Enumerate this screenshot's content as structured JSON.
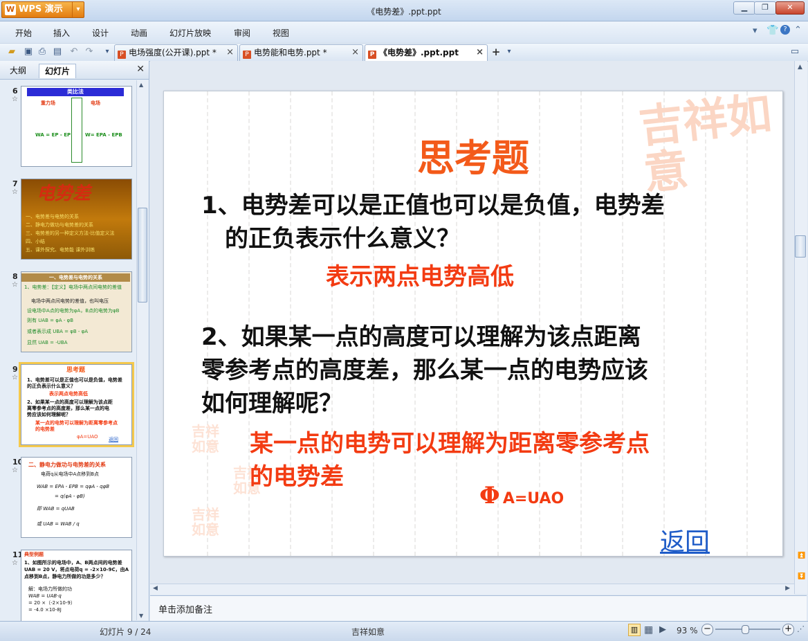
{
  "app": {
    "name": "WPS 演示",
    "window_title": "《电势差》.ppt.ppt"
  },
  "menu": [
    "开始",
    "插入",
    "设计",
    "动画",
    "幻灯片放映",
    "审阅",
    "视图"
  ],
  "tabs": [
    {
      "label": "电场强度(公开课).ppt *",
      "active": false
    },
    {
      "label": "电势能和电势.ppt *",
      "active": false
    },
    {
      "label": "《电势差》.ppt.ppt",
      "active": true
    }
  ],
  "left_panel": {
    "tabs": [
      "大纲",
      "幻灯片"
    ],
    "active_tab": "幻灯片",
    "thumbnails": [
      {
        "num": "6",
        "title": "类比法",
        "lines": [
          "重力场",
          "电场",
          "WA = EP - EP",
          "W= EPA - EPB"
        ]
      },
      {
        "num": "7",
        "title": "电势差",
        "lines": [
          "一、电势差与电势的关系",
          "二、静电力做功与电势差的关系",
          "三、电势差的另一种定义方法-比值定义法",
          "四、小结",
          "五、课外探究、电势能   课外训练"
        ]
      },
      {
        "num": "8",
        "title": "一、电势差与电势的关系",
        "lines": [
          "1、电势差：【定义】电场中两点间电势的差值",
          "电场中两点间电势的差值，也叫电压",
          "设电场中A点的电势为φA，B点的电势为φB",
          "则有  UAB = φA - φB",
          "或者表示成  UBA = φB - φA",
          "显然  UAB = -UBA"
        ]
      },
      {
        "num": "9",
        "title": "思考题",
        "lines": [
          "1、电势差可以是正值也可以是负值，电势差的正负表示什么意义？",
          "表示两点电势高低",
          "2、如果某一点的高度可以理解为该点距离零参考点的高度差，那么某一点的电势应该如何理解呢？",
          "某一点的电势可以理解为距离零参考点的电势差",
          "φA=UAO",
          "返回"
        ]
      },
      {
        "num": "10",
        "title": "二、静电力做功与电势差的关系",
        "lines": [
          "电荷q从电场中A点移到B点",
          "WAB = EPA - EPB = qφA - qφB",
          "= q(φA - φB)",
          "即  WAB = qUAB",
          "或  UAB = WAB / q"
        ]
      },
      {
        "num": "11",
        "title": "典型例题",
        "lines": [
          "1、如图所示的电场中，A、B两点间的电势差",
          "UAB = 20 V，将点电荷q = -2×10-9C，由A",
          "点移到B点，静电力所做的功是多少？",
          "解：电场力所做的功",
          "WAB = UAB·q",
          "= 20 ×（-2×10-9）",
          "= -4.0 ×10-8J"
        ]
      }
    ]
  },
  "slide": {
    "title": "思考题",
    "q1_line1": "1、电势差可以是正值也可以是负值，电势差",
    "q1_line2": "的正负表示什么意义？",
    "a1": "表示两点电势高低",
    "q2_line1": "2、如果某一点的高度可以理解为该点距离",
    "q2_line2": "零参考点的高度差，那么某一点的电势应该",
    "q2_line3": "如何理解呢？",
    "a2_line1": "某一点的电势可以理解为距离零参考点",
    "a2_line2": "的电势差",
    "formula_phi": "Φ",
    "formula_rest": "A=UAO",
    "back": "返回",
    "stamp_text": "吉祥如意"
  },
  "notes_placeholder": "单击添加备注",
  "status": {
    "slide_counter": "幻灯片 9 / 24",
    "theme": "吉祥如意",
    "zoom": "93 %"
  }
}
